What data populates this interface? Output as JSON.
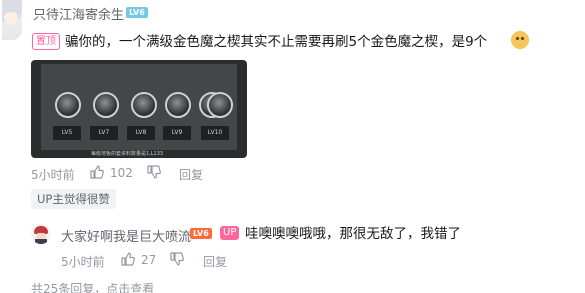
{
  "main_comment": {
    "username": "只待江海寄余生",
    "level": "LV6",
    "pinned_label": "置顶",
    "text": "骗你的，一个满级金色魔之楔其实不止需要再刷5个金色魔之楔，是9个",
    "emoji_icon": "cat-emoji-icon",
    "image": {
      "coin_levels": [
        "LV5",
        "LV7",
        "LV8",
        "LV9",
        "LV10"
      ],
      "caption": "每级地板的套资料数量是1,L133"
    },
    "time": "5小时前",
    "likes": "102",
    "reply_label": "回复",
    "up_liked_label": "UP主觉得很赞"
  },
  "reply": {
    "username": "大家好啊我是巨大喷流",
    "level": "LV6",
    "up_tag": "UP",
    "text": "哇噢噢噢哦哦，那很无敌了，我错了",
    "time": "5小时前",
    "likes": "27",
    "reply_label": "回复"
  },
  "footer": {
    "count_text": "共25条回复，",
    "view_link": "点击查看"
  },
  "colors": {
    "pink_accent": "#ff6699",
    "meta_gray": "#9499a0",
    "name_gray": "#61666d",
    "level_blue": "#73c9e5",
    "level_orange": "#ff6a3c"
  }
}
